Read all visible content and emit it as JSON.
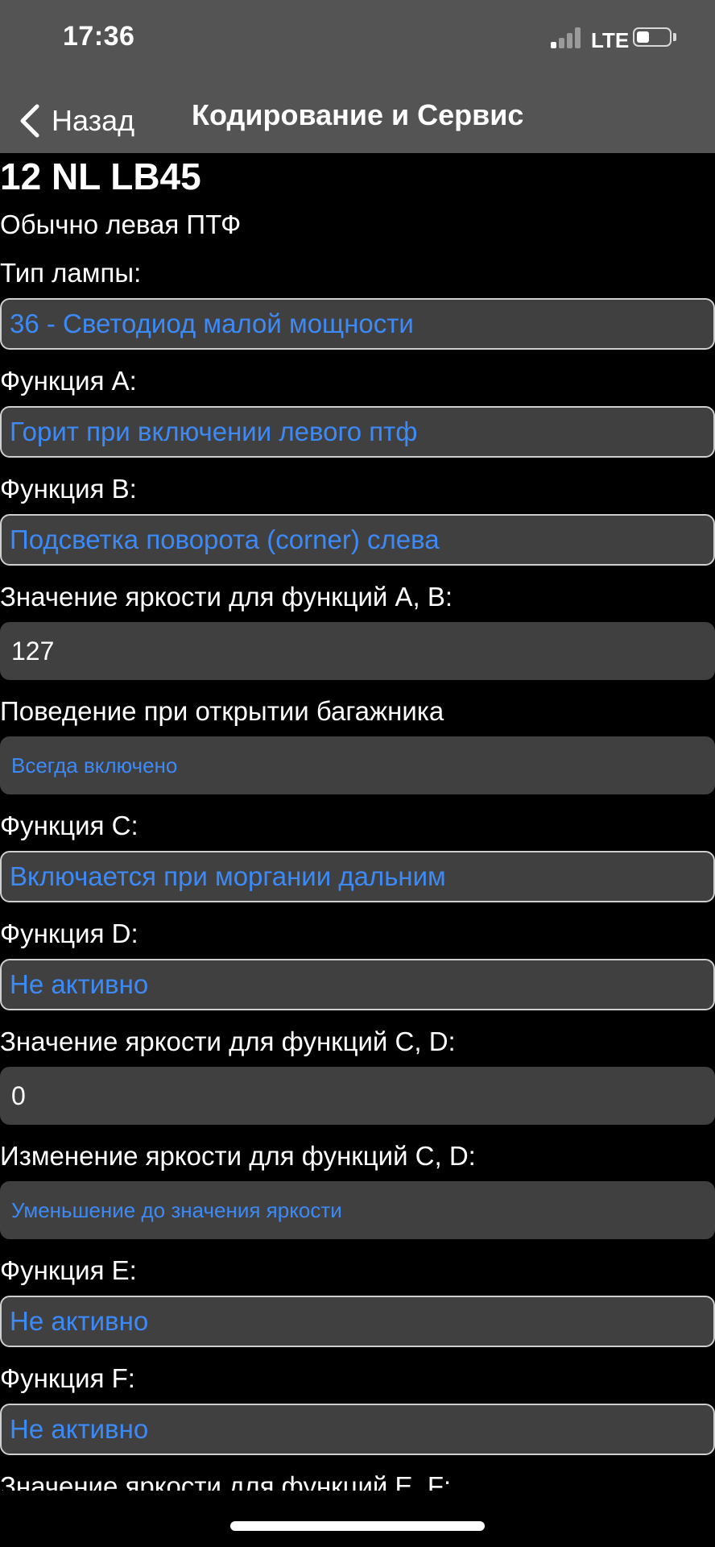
{
  "status_bar": {
    "time": "17:36",
    "network": "LTE",
    "battery_level_percent": 40,
    "signal_bars_active": 1
  },
  "nav": {
    "back_label": "Назад",
    "title": "Кодирование и Сервис"
  },
  "content": {
    "code": "12 NL LB45",
    "subtitle": "Обычно левая ПТФ",
    "lamp_type_label": "Тип лампы:",
    "lamp_type_value": "36 - Светодиод малой мощности",
    "func_a_label": "Функция A:",
    "func_a_value": "Горит при включении левого птф",
    "func_b_label": "Функция B:",
    "func_b_value": "Подсветка поворота (corner) слева",
    "brightness_ab_label": "Значение яркости для функций A, B:",
    "brightness_ab_value": "127",
    "trunk_label": "Поведение при открытии багажника",
    "trunk_value": "Всегда включено",
    "func_c_label": "Функция C:",
    "func_c_value": "Включается при моргании дальним",
    "func_d_label": "Функция D:",
    "func_d_value": "Не активно",
    "brightness_cd_label": "Значение яркости для функций C, D:",
    "brightness_cd_value": "0",
    "brightness_change_cd_label": "Изменение яркости для функций C, D:",
    "brightness_change_cd_value": "Уменьшение до значения яркости",
    "func_e_label": "Функция E:",
    "func_e_value": "Не активно",
    "func_f_label": "Функция F:",
    "func_f_value": "Не активно",
    "brightness_ef_label": "Значение яркости для функций E, F:"
  },
  "colors": {
    "accent": "#3d8af7",
    "field_bg": "#404040",
    "statusbar_bg": "#545454",
    "background": "#000000"
  },
  "icons": {
    "back": "chevron-left-icon",
    "signal": "signal-bars-icon",
    "battery": "battery-icon"
  }
}
